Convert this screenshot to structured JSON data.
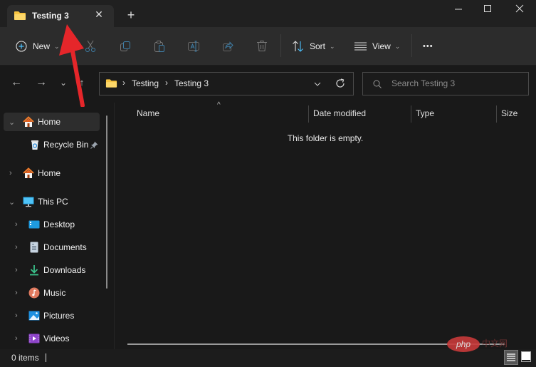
{
  "window": {
    "tab_title": "Testing 3",
    "tab_close": "✕",
    "new_tab": "+",
    "controls": {
      "minimize": "minimize",
      "maximize": "maximize",
      "close": "close"
    }
  },
  "toolbar": {
    "new_label": "New",
    "sort_label": "Sort",
    "view_label": "View",
    "more": "•••",
    "caret": "⌄",
    "actions": [
      "cut",
      "copy",
      "paste",
      "rename",
      "share",
      "delete"
    ]
  },
  "nav": {
    "back": "←",
    "forward": "→",
    "recent": "⌄",
    "up": "↑",
    "breadcrumb": [
      "Testing",
      "Testing 3"
    ],
    "crumb_sep": "›",
    "refresh": "refresh",
    "search_placeholder": "Search Testing 3"
  },
  "sidebar": {
    "items": [
      {
        "label": "Home",
        "icon": "home-icon",
        "chevron": "expanded",
        "selected": true
      },
      {
        "label": "Recycle Bin",
        "icon": "recycle-bin-icon",
        "pinned": true
      },
      {
        "label": "Home",
        "icon": "home-icon",
        "chevron": "collapsed"
      },
      {
        "label": "This PC",
        "icon": "computer-icon",
        "chevron": "expanded"
      },
      {
        "label": "Desktop",
        "icon": "desktop-icon",
        "chevron": "collapsed"
      },
      {
        "label": "Documents",
        "icon": "documents-icon",
        "chevron": "collapsed"
      },
      {
        "label": "Downloads",
        "icon": "downloads-icon",
        "chevron": "collapsed"
      },
      {
        "label": "Music",
        "icon": "music-icon",
        "chevron": "collapsed"
      },
      {
        "label": "Pictures",
        "icon": "pictures-icon",
        "chevron": "collapsed"
      },
      {
        "label": "Videos",
        "icon": "videos-icon",
        "chevron": "collapsed"
      }
    ]
  },
  "content": {
    "columns": [
      "Name",
      "Date modified",
      "Type",
      "Size"
    ],
    "sort_indicator": "^",
    "empty_message": "This folder is empty."
  },
  "status": {
    "item_count": "0 items"
  },
  "watermark": {
    "logo": "php",
    "text": "中文网"
  },
  "colors": {
    "accent": "#4cc2ff",
    "folder": "#f8c440",
    "annotation_arrow": "#e5262a"
  }
}
